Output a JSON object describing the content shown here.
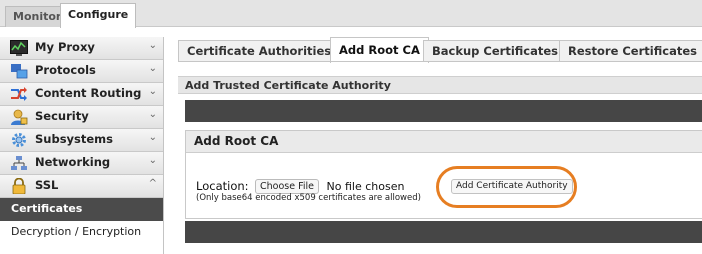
{
  "top_tabs": {
    "monitor": "Monitor",
    "configure": "Configure"
  },
  "sidebar": {
    "items": [
      {
        "label": "My Proxy",
        "icon": "monitor-chart-icon",
        "chevron": "⌄"
      },
      {
        "label": "Protocols",
        "icon": "protocols-icon",
        "chevron": "⌄"
      },
      {
        "label": "Content Routing",
        "icon": "routing-arrows-icon",
        "chevron": "⌄"
      },
      {
        "label": "Security",
        "icon": "security-user-icon",
        "chevron": "⌄"
      },
      {
        "label": "Subsystems",
        "icon": "gear-icon",
        "chevron": "⌄"
      },
      {
        "label": "Networking",
        "icon": "network-icon",
        "chevron": "⌄"
      },
      {
        "label": "SSL",
        "icon": "lock-icon",
        "chevron": "^"
      }
    ],
    "subitems": [
      "Certificates",
      "Decryption / Encryption"
    ]
  },
  "tabs": [
    "Certificate Authorities",
    "Add Root CA",
    "Backup Certificates",
    "Restore Certificates"
  ],
  "active_tab": "Add Root CA",
  "section_title": "Add Trusted Certificate Authority",
  "panel": {
    "title": "Add Root CA",
    "location_label": "Location:",
    "choose_file_label": "Choose File",
    "no_file_text": "No file chosen",
    "hint": "(Only base64 encoded x509 certificates are allowed)",
    "add_button_label": "Add Certificate Authority"
  },
  "colors": {
    "highlight": "#e67e22",
    "dark_bar": "#464646",
    "active_sidebar": "#4b4b4b"
  }
}
